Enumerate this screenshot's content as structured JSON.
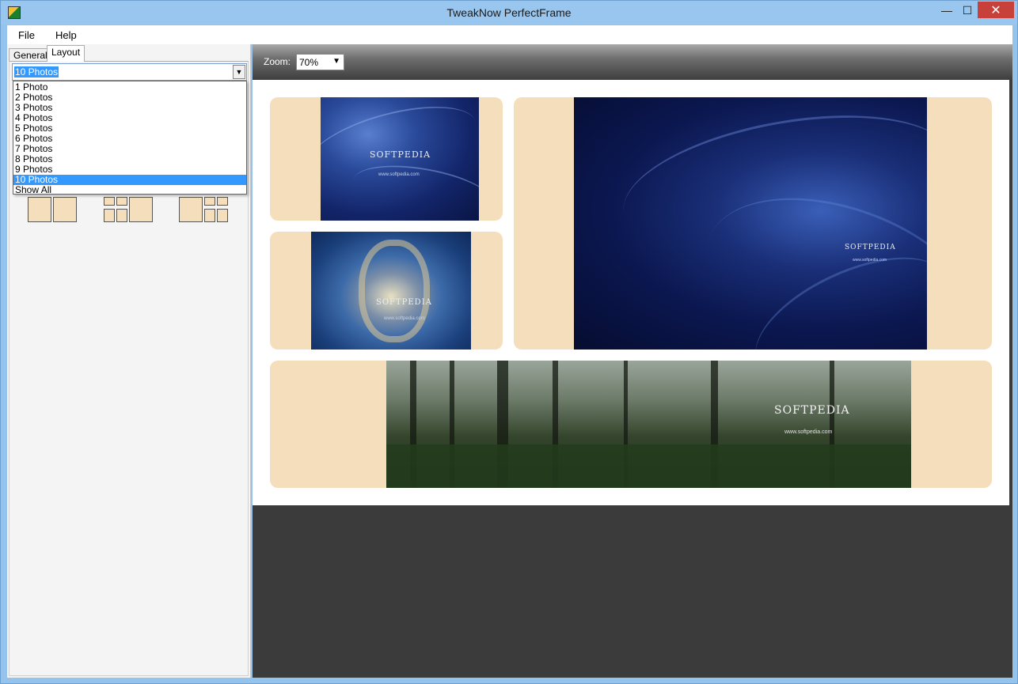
{
  "window": {
    "title": "TweakNow PerfectFrame",
    "minimize_glyph": "—",
    "maximize_glyph": "☐",
    "close_glyph": "✕"
  },
  "menu": {
    "file": "File",
    "help": "Help"
  },
  "tabs": {
    "general": "General",
    "layout": "Layout"
  },
  "layout_combo": {
    "selected": "10 Photos",
    "options": [
      "1 Photo",
      "2 Photos",
      "3 Photos",
      "4 Photos",
      "5 Photos",
      "6 Photos",
      "7 Photos",
      "8 Photos",
      "9 Photos",
      "10 Photos",
      "Show All"
    ],
    "selected_index": 9
  },
  "toolbar": {
    "zoom_label": "Zoom:",
    "zoom_value": "70%"
  },
  "photos": {
    "watermark": "SOFTPEDIA",
    "watermark_url": "www.softpedia.com"
  },
  "colors": {
    "frame_fill": "#f5debb",
    "selection": "#3399ff",
    "canvas_bg": "#3b3b3b"
  }
}
